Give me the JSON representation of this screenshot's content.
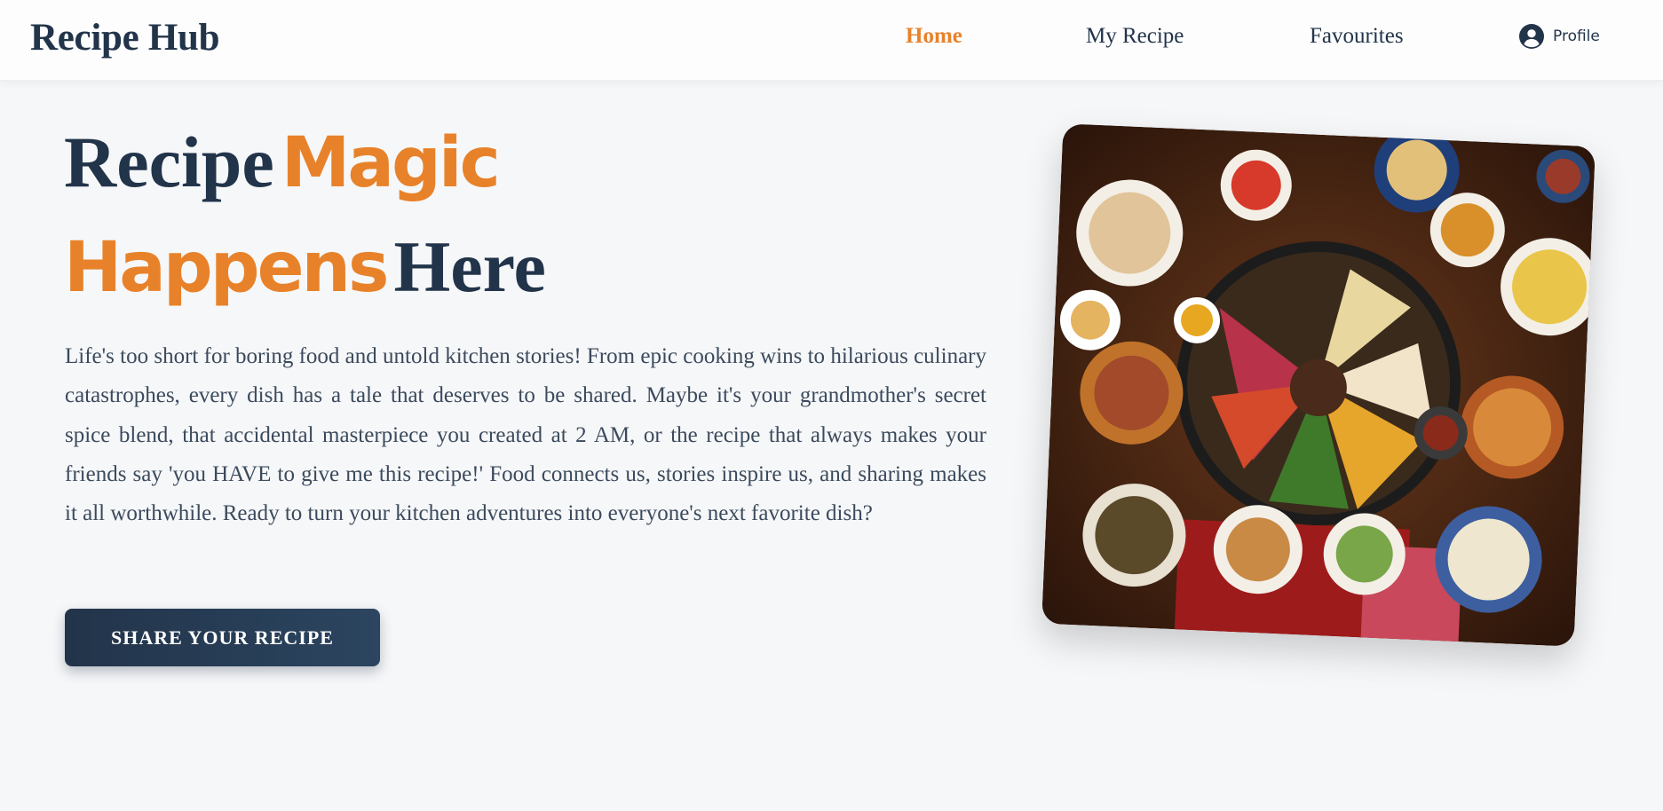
{
  "nav": {
    "logo": "Recipe Hub",
    "links": [
      {
        "label": "Home",
        "active": true
      },
      {
        "label": "My Recipe",
        "active": false
      },
      {
        "label": "Favourites",
        "active": false
      }
    ],
    "profile": {
      "label": "Profile",
      "icon": "user-circle-icon"
    }
  },
  "hero": {
    "title_line1_plain": "Recipe",
    "title_line1_accent": "Magic",
    "title_line2_accent": "Happens",
    "title_line2_plain": "Here",
    "description": "Life's too short for boring food and untold kitchen stories! From epic cooking wins to hilarious culinary catastrophes, every dish has a tale that deserves to be shared. Maybe it's your grandmother's secret spice blend, that accidental masterpiece you created at 2 AM, or the recipe that always makes your friends say 'you HAVE to give me this recipe!' Food connects us, stories inspire us, and sharing makes it all worthwhile. Ready to turn your kitchen adventures into everyone's next favorite dish?",
    "cta_label": "SHARE YOUR RECIPE",
    "image": "food-spread-image"
  },
  "colors": {
    "primary": "#22344a",
    "accent": "#e8822a",
    "background": "#f6f7f9",
    "text_muted": "#3b4a5c"
  }
}
